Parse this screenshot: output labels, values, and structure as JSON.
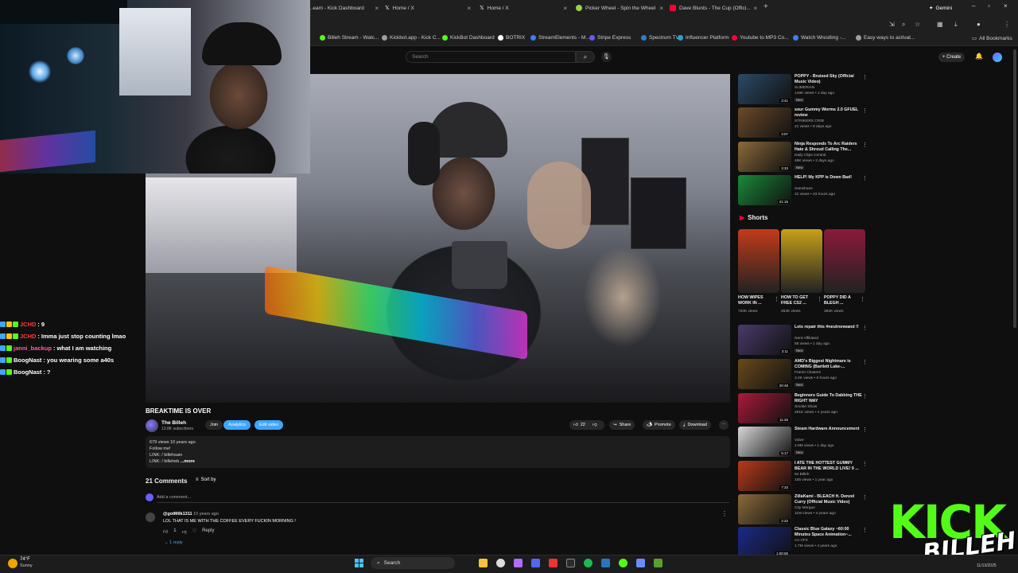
{
  "browser": {
    "tabs": [
      {
        "title": "...eam - Kick Dashboard",
        "color": "#53fc18"
      },
      {
        "title": "Home / X",
        "color": "#ffffff"
      },
      {
        "title": "Home / X",
        "color": "#ffffff"
      },
      {
        "title": "Picker Wheel - Spin the Wheel",
        "color": "#9ad14b"
      },
      {
        "title": "Dave Blunts - The Cup (Offici...",
        "color": "#ff0033"
      }
    ],
    "gemini_label": "Gemini",
    "bookmarks": [
      {
        "label": "Billeh Stream - Watc...",
        "color": "#53fc18"
      },
      {
        "label": "Kickbot.app - Kick C...",
        "color": "#9e9e9e"
      },
      {
        "label": "KickBot Dashboard",
        "color": "#53fc18"
      },
      {
        "label": "BOTRIX",
        "color": "#ffffff"
      },
      {
        "label": "StreamElements - M...",
        "color": "#3a7dff"
      },
      {
        "label": "Stripe Express",
        "color": "#635bff"
      },
      {
        "label": "Spectrum TV",
        "color": "#2a7fd4"
      },
      {
        "label": "Influencer Platform",
        "color": "#2a9fd4"
      },
      {
        "label": "Youtube to MP3 Co...",
        "color": "#ff0033"
      },
      {
        "label": "Watch Wrestling -...",
        "color": "#3a7dff"
      },
      {
        "label": "Easy ways to activat...",
        "color": "#9e9e9e"
      }
    ],
    "all_bookmarks": "All Bookmarks"
  },
  "youtube": {
    "search_placeholder": "Search",
    "create_label": "+ Create"
  },
  "chat": [
    {
      "user": "JCHD",
      "msg": "9",
      "user_color": "#ff3b3b",
      "badges": [
        "#3ea6ff",
        "#f5c518",
        "#53fc18"
      ]
    },
    {
      "user": "JCHD",
      "msg": "Imma just stop counting lmao",
      "user_color": "#ff3b3b",
      "badges": [
        "#3ea6ff",
        "#f5c518",
        "#53fc18"
      ]
    },
    {
      "user": "janni_backup",
      "msg": "what I am watching",
      "user_color": "#ff5fa2",
      "badges": [
        "#3ea6ff",
        "#53fc18"
      ]
    },
    {
      "user": "BoogNast",
      "msg": "you wearing some a40s",
      "user_color": "#ffffff",
      "badges": [
        "#3ea6ff",
        "#53fc18"
      ]
    },
    {
      "user": "BoogNast",
      "msg": "?",
      "user_color": "#ffffff",
      "badges": [
        "#3ea6ff",
        "#53fc18"
      ]
    }
  ],
  "video": {
    "title": "BREAKTIME IS OVER",
    "channel": "The Billeh",
    "subscribers": "13.8K subscribers",
    "join": "Join",
    "analytics": "Analytics",
    "edit_video": "Edit video",
    "likes": "22",
    "share": "Share",
    "promote": "Promote",
    "download": "Download",
    "desc_line1": "679 views  10 years ago",
    "desc_line2": "Follow me!",
    "desc_line3": "LINK:  / billehsain",
    "desc_line4": "LINK:  / billeheb",
    "desc_more": "...more"
  },
  "comments": {
    "count": "21 Comments",
    "sort_by": "Sort by",
    "add_placeholder": "Add a comment...",
    "items": [
      {
        "author": "@gotMilk1311",
        "ago": "10 years ago",
        "text": "LOL THAT IS ME WITH THE COFFEE EVERY FUCKIN MORNING !",
        "likes": "1",
        "reply": "Reply",
        "replies": "1 reply"
      }
    ]
  },
  "sidebar": {
    "videos_top": [
      {
        "title": "POPPY - Bruised Sky (Official Music Video)",
        "channel": "SUMERIAN",
        "meta": "146K views • 1 day ago",
        "new": "New",
        "duration": "3:41",
        "color": "#2b4a66"
      },
      {
        "title": "sour Gummy Worms 2.0 GFUEL review",
        "channel": "STRIKERS CRIB",
        "meta": "21 views • 8 days ago",
        "new": "",
        "duration": "3:07",
        "color": "#6b4a2a"
      },
      {
        "title": "Ninja Responds To Arc Raiders Hate & Shroud Calling The...",
        "channel": "Daily Clips Central",
        "meta": "48K views • 2 days ago",
        "new": "New",
        "duration": "3:33",
        "color": "#8a6a3a"
      },
      {
        "title": "HELP! My KPP is Down Bad!",
        "channel": "Samshane",
        "meta": "31 views • 23 hours ago",
        "new": "",
        "duration": "21:16",
        "color": "#1a8a3a"
      }
    ],
    "shorts_label": "Shorts",
    "shorts": [
      {
        "title": "HOW WIPES WORK IN ...",
        "views": "720K views",
        "color": "#c23b1a"
      },
      {
        "title": "HOW TO GET FREE CS2 ...",
        "views": "264K views",
        "color": "#c8a01a"
      },
      {
        "title": "POPPY DID A BLEGH ...",
        "views": "382K views",
        "color": "#8a1a3a"
      }
    ],
    "videos_bottom": [
      {
        "title": "Lets repair this #neutronwand !!",
        "channel": "Nerd Affiliated",
        "meta": "58 views • 1 day ago",
        "new": "New",
        "duration": "3:11",
        "color": "#4a3a6a"
      },
      {
        "title": "AMD's Biggest Nightmare is COMING (Bartlett Lake-...",
        "channel": "Frame Chasers",
        "meta": "3.4K views • 6 hours ago",
        "new": "New",
        "duration": "20:48",
        "color": "#6a4a1a"
      },
      {
        "title": "Beginners Guide To Dabbing THE RIGHT WAY",
        "channel": "Smoke Show",
        "meta": "291K views • 4 years ago",
        "new": "",
        "duration": "11:26",
        "color": "#aa1a3a"
      },
      {
        "title": "Steam Hardware Announcement",
        "channel": "Valve",
        "meta": "2.9M views • 1 day ago",
        "new": "New",
        "duration": "5:17",
        "color": "#d8d8d8"
      },
      {
        "title": "I ATE THE HOTTEST GUMMY BEAR IN THE WORLD LIVE! 9 ...",
        "channel": "94 Billeh",
        "meta": "155 views • 1 year ago",
        "new": "",
        "duration": "7:33",
        "color": "#b83a1a"
      },
      {
        "title": "ZillaKami - BLEACH ft. Denzel Curry (Official Music Video)",
        "channel": "City Morgue",
        "meta": "11M views • 4 years ago",
        "new": "",
        "duration": "2:22",
        "color": "#8a6a3a"
      },
      {
        "title": "Classic Blue Galaxy ~60:00 Minutes Space Animation~...",
        "channel": "AA VFX",
        "meta": "1.7M views • 4 years ago",
        "new": "",
        "duration": "1:00:00",
        "color": "#1a2a8a"
      }
    ]
  },
  "overlay": {
    "kick": "KICK",
    "streamer": "BILLEH"
  },
  "taskbar": {
    "temp": "74°F",
    "condition": "Sunny",
    "search": "Search",
    "clock": "11/13/2025"
  }
}
